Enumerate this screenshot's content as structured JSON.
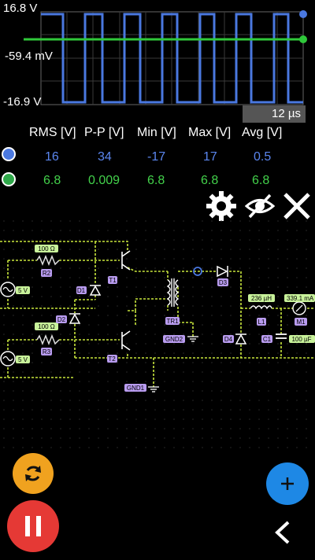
{
  "scope": {
    "y_top": "16.8 V",
    "y_mid": "-59.4 mV",
    "y_bottom": "-16.9 V",
    "timebase": "12 µs",
    "colors": {
      "ch1": "#4a78e0",
      "ch2": "#2fc83a",
      "grid": "#444444"
    }
  },
  "measurements": {
    "headers": [
      "RMS [V]",
      "P-P [V]",
      "Min [V]",
      "Max [V]",
      "Avg [V]"
    ],
    "ch1": [
      "16",
      "34",
      "-17",
      "17",
      "0.5"
    ],
    "ch2": [
      "6.8",
      "0.009",
      "6.8",
      "6.8",
      "6.8"
    ]
  },
  "toolbar": {
    "settings_icon": "gear-icon",
    "visibility_icon": "eye-off-icon",
    "close_icon": "close-icon"
  },
  "circuit": {
    "labels": {
      "r2_value": "100 Ω",
      "r2_name": "R2",
      "r3_value": "100 Ω",
      "r3_name": "R3",
      "source1": "5 V",
      "source2": "5 V",
      "t1": "T1",
      "t2": "T2",
      "d1": "D1",
      "d2": "D2",
      "d3": "D3",
      "d4": "D4",
      "tr1": "TR1",
      "gnd2": "GND2",
      "gnd1": "GND1",
      "l1_value": "236 µH",
      "l1_name": "L1",
      "c1_value": "100 µF",
      "c1_name": "C1",
      "m1_value": "339.1 mA",
      "m1_name": "M1"
    }
  },
  "actions": {
    "refresh_icon": "refresh-icon",
    "pause_icon": "pause-icon",
    "add_icon": "plus-icon",
    "back_icon": "chevron-left-icon"
  }
}
